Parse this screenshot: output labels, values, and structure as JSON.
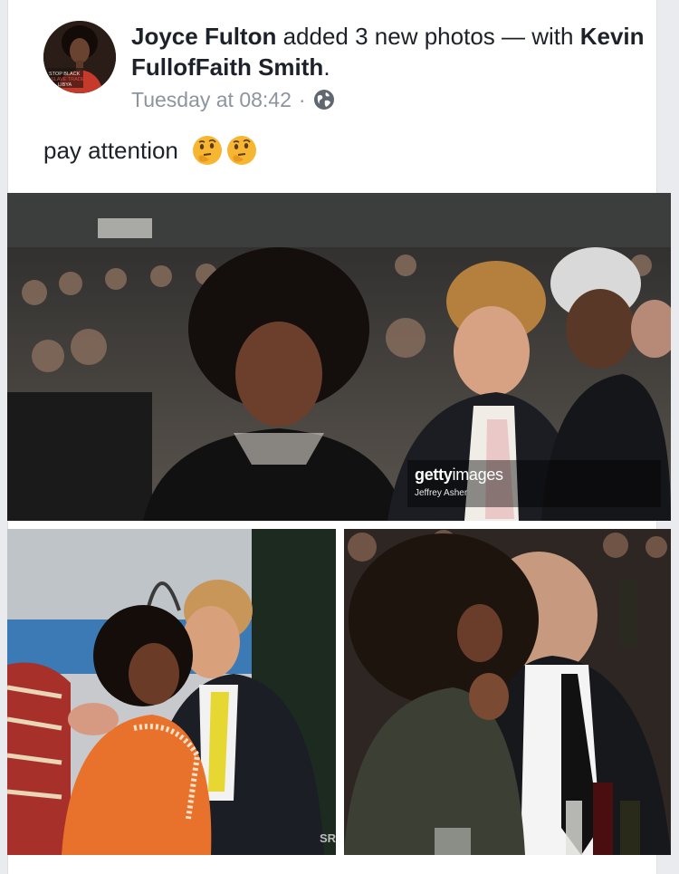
{
  "post": {
    "author": "Joyce Fulton",
    "action_text": "added 3 new photos — with",
    "tagged": "Kevin FullofFaith Smith",
    "tagged_suffix": ".",
    "timestamp": "Tuesday at 08:42",
    "separator": "·",
    "privacy_icon": "globe-icon",
    "text": "pay attention",
    "emojis": [
      "thinking-face-emoji",
      "thinking-face-emoji"
    ]
  },
  "avatar_badge": {
    "line1": "STOP BLACK",
    "line2": "SLAVE TRADE",
    "line3": "LIBYA"
  },
  "photos": [
    {
      "id": "photo-1",
      "watermark_brand_bold": "getty",
      "watermark_brand_light": "images",
      "watermark_credit": "Jeffrey Asher"
    },
    {
      "id": "photo-2",
      "corner_mark": "SR"
    },
    {
      "id": "photo-3"
    }
  ],
  "colors": {
    "text_primary": "#1d2129",
    "text_secondary": "#8d949e",
    "card_background": "#ffffff",
    "page_background": "#e9ebee"
  }
}
